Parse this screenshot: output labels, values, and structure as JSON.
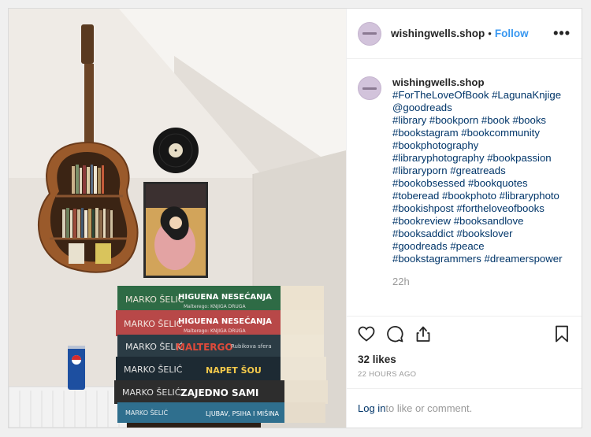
{
  "header": {
    "username": "wishingwells.shop",
    "separator": "•",
    "follow_label": "Follow",
    "more_icon": "more-options-icon"
  },
  "caption": {
    "username": "wishingwells.shop",
    "text": "#ForTheLoveOfBook #LagunaKnjige\n@goodreads\n#library #bookporn #book #books\n#bookstagram #bookcommunity\n#bookphotography\n#libraryphotography #bookpassion\n#libraryporn #greatreads\n#bookobsessed #bookquotes\n#toberead #bookphoto #libraryphoto\n#bookishpost #fortheloveofbooks\n#bookreview #booksandlove\n#booksaddict #bookslover\n#goodreads #peace\n#bookstagrammers #dreamerspower",
    "time": "22h"
  },
  "actions": {
    "like_icon": "heart-icon",
    "comment_icon": "comment-icon",
    "share_icon": "share-icon",
    "save_icon": "bookmark-icon"
  },
  "likes": "32 likes",
  "posted_ago": "22 HOURS AGO",
  "login": {
    "link": "Log in",
    "rest": " to like or comment."
  },
  "photo": {
    "books": [
      {
        "author": "MARKO ŠELIĆ",
        "title": "HIGUENA NESEĆANJA",
        "subtitle": "Malterego: KNJIGA DRUGA",
        "color": "#2e6b45"
      },
      {
        "author": "MARKO ŠELIĆ",
        "title": "HIGUENA NESEĆANJA",
        "subtitle": "Malterego: KNJIGA DRUGA",
        "color": "#b84848"
      },
      {
        "author": "MARKO ŠELIĆ",
        "title": "MALTERGO",
        "subtitle": "Rubikova sfera",
        "color": "#2b3c45"
      },
      {
        "author": "MARKO ŠELIĆ",
        "title": "NAPET ŠOU",
        "subtitle": "",
        "color": "#1d2a33"
      },
      {
        "author": "MARKO ŠELIĆ",
        "title": "ZAJEDNO SAMI",
        "subtitle": "",
        "color": "#2d2d2d"
      },
      {
        "author": "MARKO ŠELIĆ",
        "title": "LJUBAV, PSIHA I MIŠINA",
        "subtitle": "",
        "color": "#2f6f8e"
      }
    ]
  }
}
